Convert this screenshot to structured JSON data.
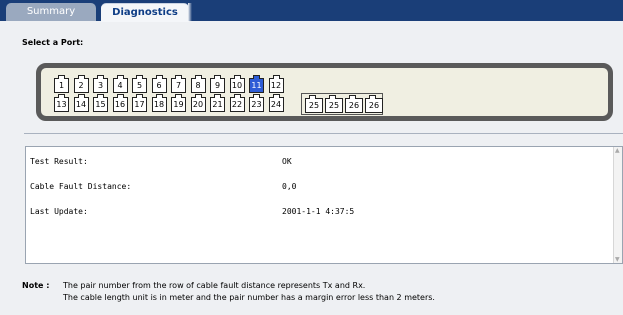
{
  "tabs": [
    {
      "label": "Summary"
    },
    {
      "label": "Diagnostics"
    }
  ],
  "select_label": "Select a Port:",
  "ports_row1": [
    "1",
    "2",
    "3",
    "4",
    "5",
    "6",
    "7",
    "8",
    "9",
    "10",
    "11",
    "12"
  ],
  "ports_row2": [
    "13",
    "14",
    "15",
    "16",
    "17",
    "18",
    "19",
    "20",
    "21",
    "22",
    "23",
    "24"
  ],
  "sfp_ports": [
    "25",
    "25",
    "26",
    "26"
  ],
  "selected_port": "11",
  "colors": {
    "selected": "#2e5cd6",
    "tabbar": "#1a3e78"
  },
  "results": {
    "test_result_label": "Test Result:",
    "test_result_value": "OK",
    "fault_distance_label": "Cable Fault Distance:",
    "fault_distance_value": "0,0",
    "last_update_label": "Last Update:",
    "last_update_value": "2001-1-1 4:37:5"
  },
  "note": {
    "label": "Note :",
    "line1": "The pair number from the row of cable fault distance represents Tx and Rx.",
    "line2": "The cable length unit is in meter and the pair number has a margin error less than 2 meters."
  }
}
